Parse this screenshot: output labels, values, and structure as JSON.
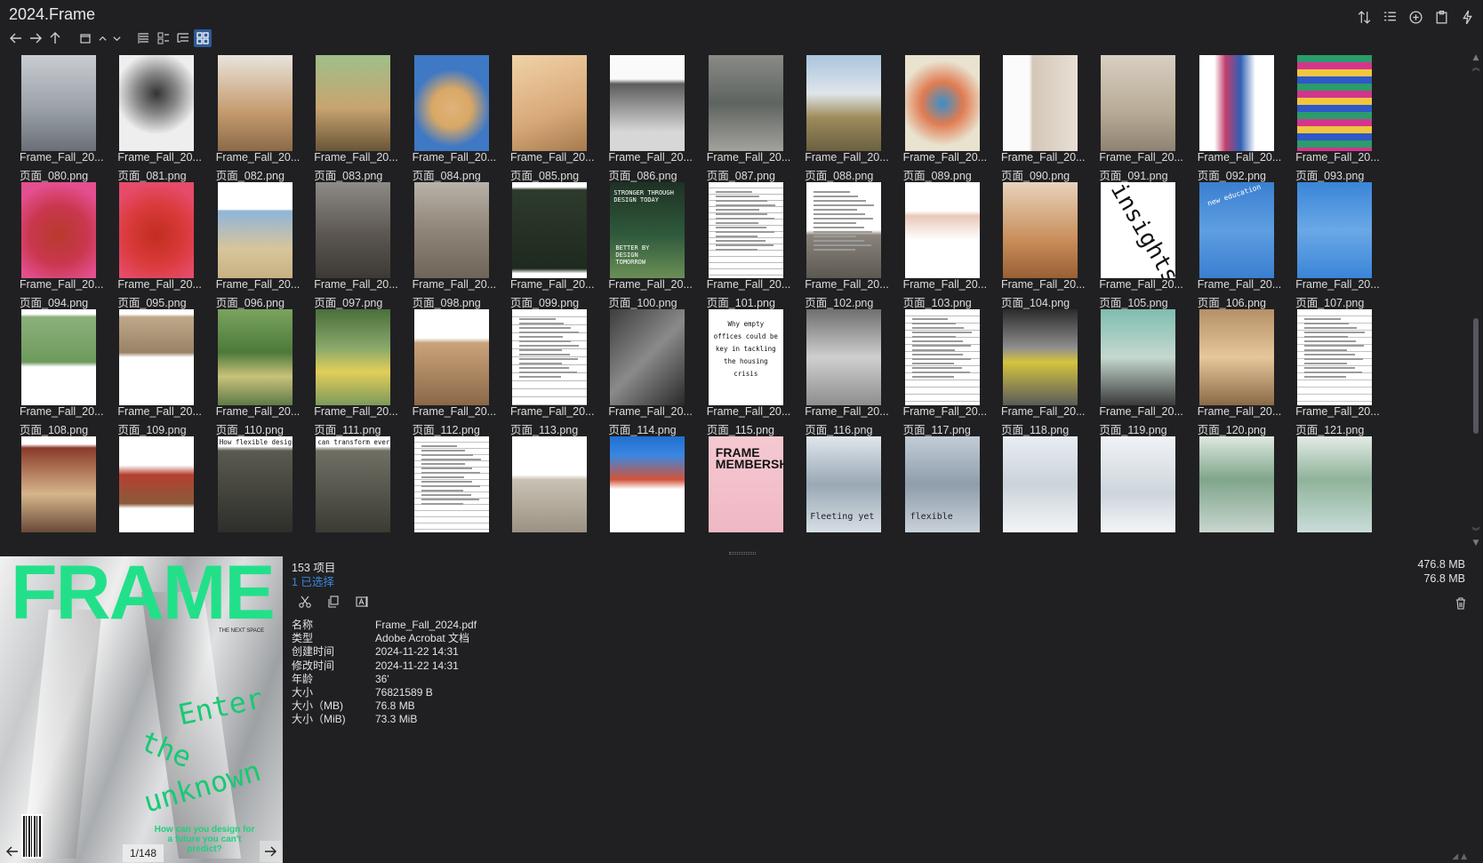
{
  "window": {
    "title": "2024.Frame"
  },
  "icons": {
    "back": "arrow-left-icon",
    "forward": "arrow-right-icon",
    "up": "arrow-up-icon",
    "tab": "tab-icon",
    "collapse": "chevron-up-icon",
    "expand": "chevron-down-icon",
    "view_details": "list-details-icon",
    "view_list": "list-thumbs-icon",
    "view_tree": "list-tree-icon",
    "view_grid": "grid-icon",
    "sort": "sort-icon",
    "columns": "columns-icon",
    "add": "add-circle-icon",
    "clipboard": "clipboard-icon",
    "lightning": "lightning-icon",
    "cut": "scissors-icon",
    "copy": "copy-icon",
    "rename": "rename-icon",
    "delete": "trash-icon"
  },
  "colors": {
    "accent": "#3b86d8",
    "active_view": "#2f5a96",
    "background": "#202022",
    "cover_green": "#22e08a"
  },
  "grid": {
    "items": [
      {
        "name": "Frame_Fall_20...",
        "file": "页面_080.png"
      },
      {
        "name": "Frame_Fall_20...",
        "file": "页面_081.png"
      },
      {
        "name": "Frame_Fall_20...",
        "file": "页面_082.png"
      },
      {
        "name": "Frame_Fall_20...",
        "file": "页面_083.png"
      },
      {
        "name": "Frame_Fall_20...",
        "file": "页面_084.png"
      },
      {
        "name": "Frame_Fall_20...",
        "file": "页面_085.png"
      },
      {
        "name": "Frame_Fall_20...",
        "file": "页面_086.png"
      },
      {
        "name": "Frame_Fall_20...",
        "file": "页面_087.png"
      },
      {
        "name": "Frame_Fall_20...",
        "file": "页面_088.png"
      },
      {
        "name": "Frame_Fall_20...",
        "file": "页面_089.png"
      },
      {
        "name": "Frame_Fall_20...",
        "file": "页面_090.png"
      },
      {
        "name": "Frame_Fall_20...",
        "file": "页面_091.png"
      },
      {
        "name": "Frame_Fall_20...",
        "file": "页面_092.png"
      },
      {
        "name": "Frame_Fall_20...",
        "file": "页面_093.png"
      },
      {
        "name": "Frame_Fall_20...",
        "file": "页面_094.png"
      },
      {
        "name": "Frame_Fall_20...",
        "file": "页面_095.png"
      },
      {
        "name": "Frame_Fall_20...",
        "file": "页面_096.png"
      },
      {
        "name": "Frame_Fall_20...",
        "file": "页面_097.png"
      },
      {
        "name": "Frame_Fall_20...",
        "file": "页面_098.png"
      },
      {
        "name": "Frame_Fall_20...",
        "file": "页面_099.png"
      },
      {
        "name": "Frame_Fall_20...",
        "file": "页面_100.png"
      },
      {
        "name": "Frame_Fall_20...",
        "file": "页面_101.png"
      },
      {
        "name": "Frame_Fall_20...",
        "file": "页面_102.png"
      },
      {
        "name": "Frame_Fall_20...",
        "file": "页面_103.png"
      },
      {
        "name": "Frame_Fall_20...",
        "file": "页面_104.png"
      },
      {
        "name": "Frame_Fall_20...",
        "file": "页面_105.png"
      },
      {
        "name": "Frame_Fall_20...",
        "file": "页面_106.png"
      },
      {
        "name": "Frame_Fall_20...",
        "file": "页面_107.png"
      },
      {
        "name": "Frame_Fall_20...",
        "file": "页面_108.png"
      },
      {
        "name": "Frame_Fall_20...",
        "file": "页面_109.png"
      },
      {
        "name": "Frame_Fall_20...",
        "file": "页面_110.png"
      },
      {
        "name": "Frame_Fall_20...",
        "file": "页面_111.png"
      },
      {
        "name": "Frame_Fall_20...",
        "file": "页面_112.png"
      },
      {
        "name": "Frame_Fall_20...",
        "file": "页面_113.png"
      },
      {
        "name": "Frame_Fall_20...",
        "file": "页面_114.png"
      },
      {
        "name": "Frame_Fall_20...",
        "file": "页面_115.png"
      },
      {
        "name": "Frame_Fall_20...",
        "file": "页面_116.png"
      },
      {
        "name": "Frame_Fall_20...",
        "file": "页面_117.png"
      },
      {
        "name": "Frame_Fall_20...",
        "file": "页面_118.png"
      },
      {
        "name": "Frame_Fall_20...",
        "file": "页面_119.png"
      },
      {
        "name": "Frame_Fall_20...",
        "file": "页面_120.png"
      },
      {
        "name": "Frame_Fall_20...",
        "file": "页面_121.png"
      },
      {
        "name": "",
        "file": ""
      },
      {
        "name": "",
        "file": ""
      },
      {
        "name": "",
        "file": ""
      },
      {
        "name": "",
        "file": ""
      },
      {
        "name": "",
        "file": ""
      },
      {
        "name": "",
        "file": ""
      },
      {
        "name": "",
        "file": ""
      },
      {
        "name": "",
        "file": ""
      },
      {
        "name": "",
        "file": ""
      },
      {
        "name": "",
        "file": ""
      },
      {
        "name": "",
        "file": ""
      },
      {
        "name": "",
        "file": ""
      },
      {
        "name": "",
        "file": ""
      },
      {
        "name": "",
        "file": ""
      }
    ],
    "thumb_text": {
      "stronger": "STRONGER THROUGH DESIGN TODAY",
      "better": "BETTER BY DESIGN TOMORROW",
      "insights": "insights",
      "new_education": "new education",
      "why_empty": "Why empty offices could be key in tackling the housing crisis",
      "how_flexible": "How flexible design",
      "can_transform": "can transform every",
      "frame_memberships": "FRAME MEMBERSHIPS",
      "fleeting": "Fleeting yet",
      "flexible": "flexible"
    }
  },
  "preview": {
    "cover_title": "FRAME",
    "cover_subtitle": "THE NEXT SPACE",
    "cover_lines": [
      "Enter",
      "the",
      "unknown"
    ],
    "cover_tagline": "How can you design for a future you can't predict?",
    "page_indicator": "1/148"
  },
  "info": {
    "item_count": "153 项目",
    "selected": "1 已选择",
    "total_size": "476.8 MB",
    "selected_size": "76.8 MB",
    "properties": [
      {
        "key": "名称",
        "value": "Frame_Fall_2024.pdf"
      },
      {
        "key": "类型",
        "value": "Adobe Acrobat 文档"
      },
      {
        "key": "创建时间",
        "value": "2024-11-22  14:31"
      },
      {
        "key": "修改时间",
        "value": "2024-11-22  14:31"
      },
      {
        "key": "年龄",
        "value": "36'"
      },
      {
        "key": "大小",
        "value": "76821589 B"
      },
      {
        "key": "大小（MB)",
        "value": "76.8 MB"
      },
      {
        "key": "大小（MiB)",
        "value": "73.3 MiB"
      }
    ]
  }
}
